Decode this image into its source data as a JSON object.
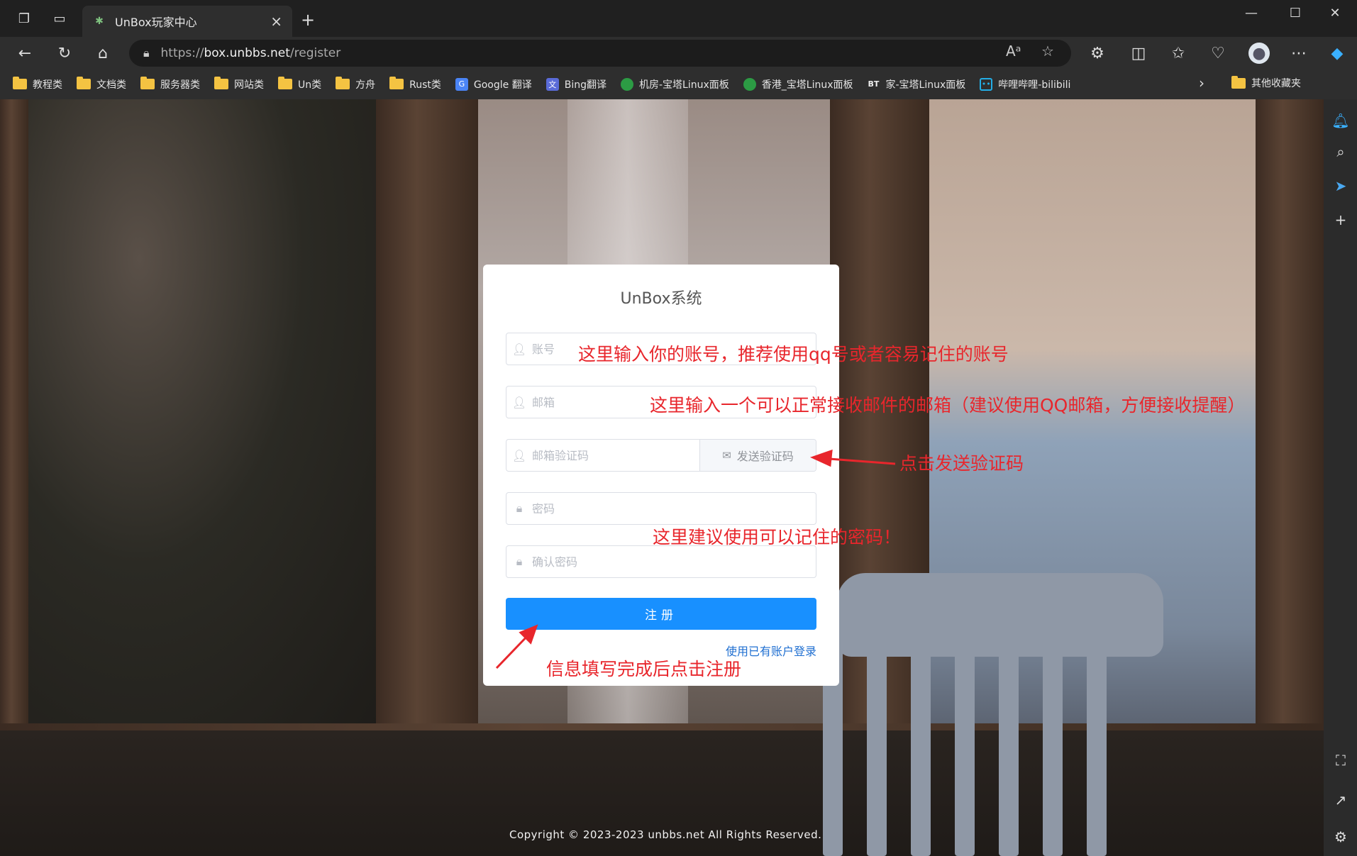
{
  "browser": {
    "tab_title": "UnBox玩家中心",
    "url_protocol": "https://",
    "url_host": "box.unbbs.net",
    "url_path": "/register"
  },
  "bookmarks": [
    {
      "label": "教程类",
      "type": "folder"
    },
    {
      "label": "文档类",
      "type": "folder"
    },
    {
      "label": "服务器类",
      "type": "folder"
    },
    {
      "label": "网站类",
      "type": "folder"
    },
    {
      "label": "Un类",
      "type": "folder"
    },
    {
      "label": "方舟",
      "type": "folder"
    },
    {
      "label": "Rust类",
      "type": "folder"
    },
    {
      "label": "Google 翻译",
      "type": "google-translate-icon"
    },
    {
      "label": "Bing翻译",
      "type": "bing-translate-icon"
    },
    {
      "label": "机房-宝塔Linux面板",
      "type": "baota-icon"
    },
    {
      "label": "香港_宝塔Linux面板",
      "type": "baota-icon"
    },
    {
      "label": "家-宝塔Linux面板",
      "type": "bt-icon"
    },
    {
      "label": "哔哩哔哩-bilibili",
      "type": "bilibili-icon"
    }
  ],
  "bookmarks_other": "其他收藏夹",
  "bt_icon_text": "BT",
  "form": {
    "title": "UnBox系统",
    "account_placeholder": "账号",
    "email_placeholder": "邮箱",
    "code_placeholder": "邮箱验证码",
    "send_code_label": "发送验证码",
    "password_placeholder": "密码",
    "confirm_placeholder": "确认密码",
    "submit_label": "注册",
    "login_link": "使用已有账户登录"
  },
  "annotations": {
    "account": "这里输入你的账号，推荐使用qq号或者容易记住的账号",
    "email": "这里输入一个可以正常接收邮件的邮箱（建议使用QQ邮箱，方便接收提醒）",
    "send_code": "点击发送验证码",
    "password": "这里建议使用可以记住的密码！",
    "submit": "信息填写完成后点击注册"
  },
  "footer": {
    "copyright": "Copyright © 2023-2023 unbbs.net All Rights Reserved."
  },
  "colors": {
    "primary_button": "#1890ff",
    "annotation_red": "#e8262c",
    "link_blue": "#1f6fd1"
  }
}
